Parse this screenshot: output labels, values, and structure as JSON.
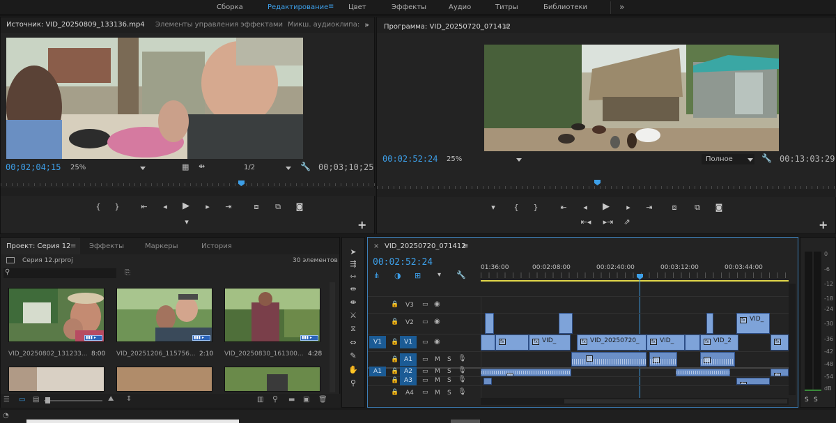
{
  "workspaces": {
    "items": [
      "Сборка",
      "Редактирование",
      "Цвет",
      "Эффекты",
      "Аудио",
      "Титры",
      "Библиотеки"
    ],
    "active": "Редактирование",
    "more": "»"
  },
  "source": {
    "tabs": [
      "Источник: VID_20250809_133136.mp4",
      "Элементы управления эффектами",
      "Микш. аудиоклипа:"
    ],
    "more": "»",
    "timecode": "00;02;04;15",
    "zoom": "25%",
    "resolution": "1/2",
    "duration": "00;03;10;25"
  },
  "program": {
    "title": "Программа: VID_20250720_071412",
    "menu": "≡",
    "timecode": "00:02:52:24",
    "zoom": "25%",
    "quality": "Полное",
    "duration": "00:13:03:29"
  },
  "project": {
    "tabs": [
      "Проект: Серия 12",
      "Эффекты",
      "Маркеры",
      "История"
    ],
    "menu": "≡",
    "file": "Серия 12.prproj",
    "count": "30 элементов",
    "search_placeholder": "",
    "items": [
      {
        "name": "VID_20250802_131233...",
        "duration": "8:00"
      },
      {
        "name": "VID_20251206_115756...",
        "duration": "2:10"
      },
      {
        "name": "VID_20250830_161300...",
        "duration": "4:28"
      }
    ]
  },
  "timeline": {
    "title": "VID_20250720_071412",
    "close": "×",
    "menu": "≡",
    "timecode": "00:02:52:24",
    "ruler": [
      "01:36:00",
      "00:02:08:00",
      "00:02:40:00",
      "00:03:12:00",
      "00:03:44:00"
    ],
    "tracks": {
      "video": [
        "V3",
        "V2",
        "V1"
      ],
      "audio": [
        "A1",
        "A2",
        "A3",
        "A4"
      ],
      "src_v": "V1",
      "src_a": "A1",
      "m": "M",
      "s": "S"
    },
    "clips": {
      "v1a": "VID_",
      "v1b": "VID_20250720_",
      "v1c": "VID_",
      "v1d": "VID_2",
      "v2": "VID_"
    }
  },
  "meter": {
    "labels": [
      "0",
      "-6",
      "-12",
      "-18",
      "-24",
      "-30",
      "-36",
      "-42",
      "-48",
      "-54",
      "dB"
    ],
    "solo": [
      "S",
      "S"
    ]
  },
  "colors": {
    "accent": "#3d9fe8",
    "clip_video": "#7ea3d9",
    "clip_audio": "#6b8fc7",
    "selected_track": "#1b5b95"
  }
}
